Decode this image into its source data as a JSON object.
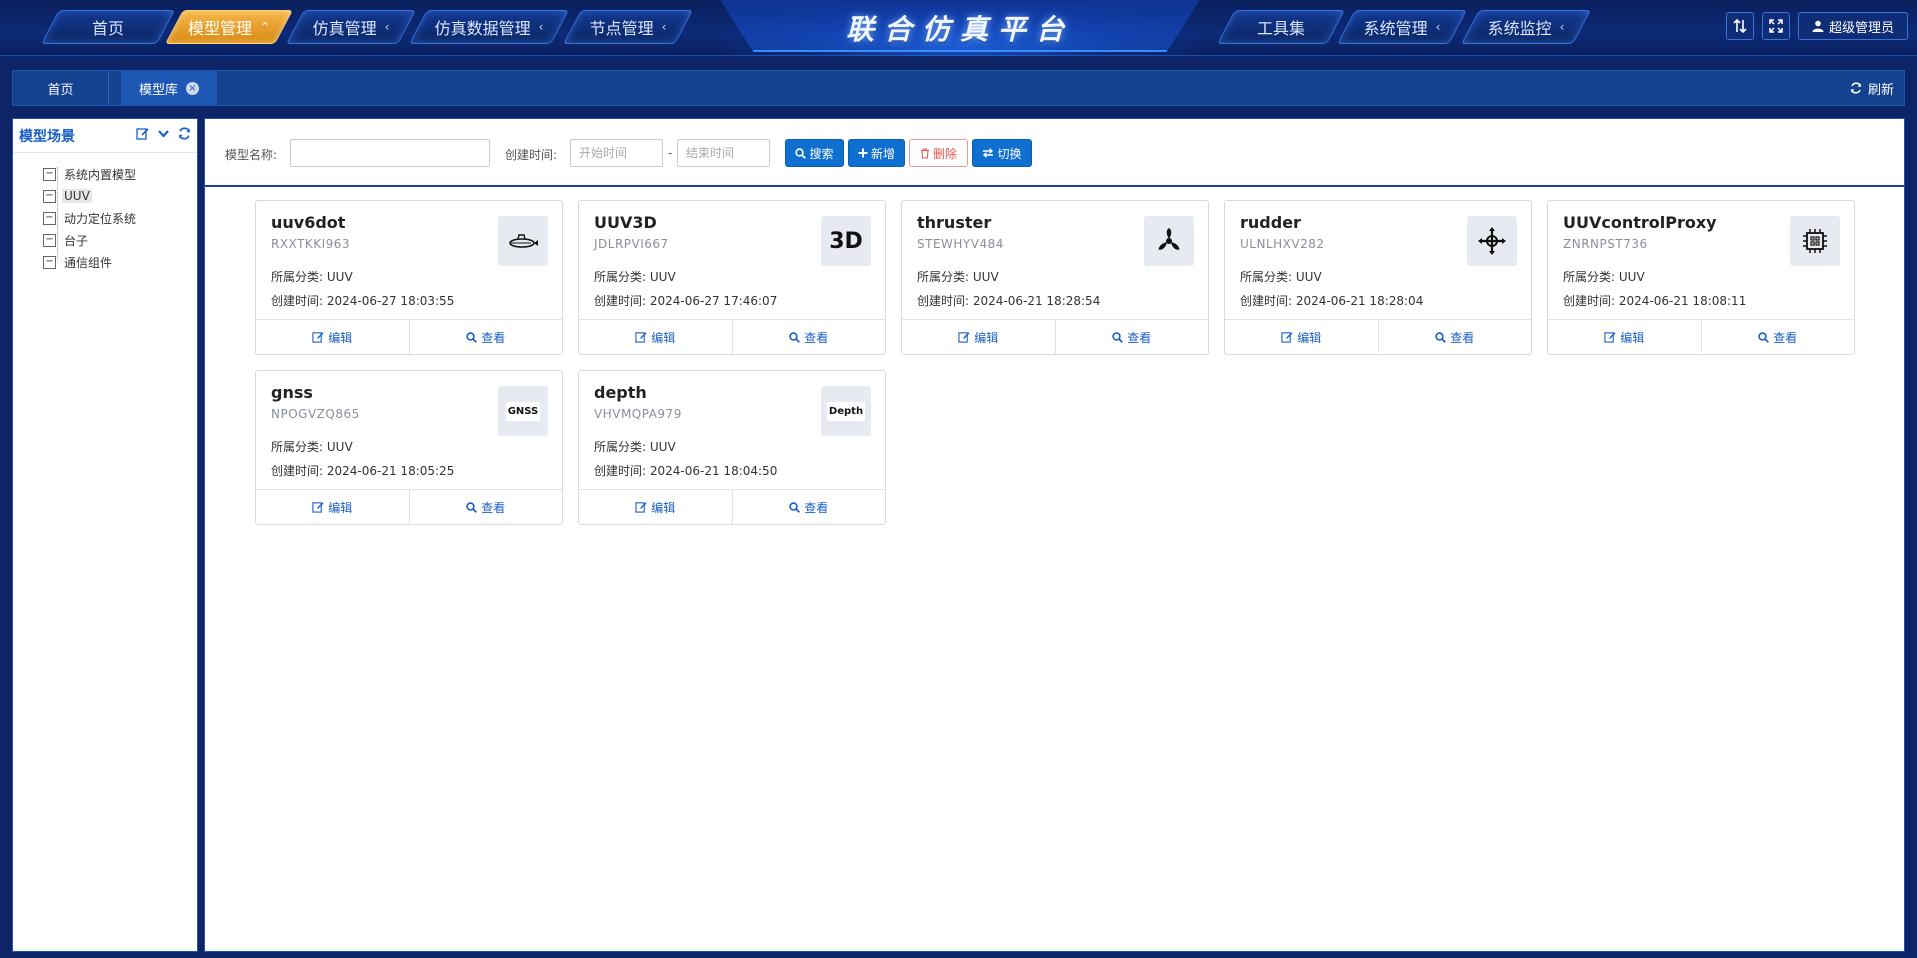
{
  "header": {
    "title": "联合仿真平台",
    "nav_left": [
      {
        "label": "首页",
        "active": false,
        "chevron": ""
      },
      {
        "label": "模型管理",
        "active": true,
        "chevron": "⌃"
      },
      {
        "label": "仿真管理",
        "active": false,
        "chevron": "‹"
      },
      {
        "label": "仿真数据管理",
        "active": false,
        "chevron": "‹"
      },
      {
        "label": "节点管理",
        "active": false,
        "chevron": "‹"
      }
    ],
    "nav_right": [
      {
        "label": "工具集",
        "chevron": ""
      },
      {
        "label": "系统管理",
        "chevron": "‹"
      },
      {
        "label": "系统监控",
        "chevron": "‹"
      }
    ],
    "user": "超级管理员"
  },
  "tabs": {
    "home": "首页",
    "current": "模型库",
    "close": "×",
    "refresh": "刷新"
  },
  "left": {
    "title": "模型场景",
    "tree": [
      {
        "label": "系统内置模型",
        "selected": false
      },
      {
        "label": "UUV",
        "selected": true
      },
      {
        "label": "动力定位系统",
        "selected": false
      },
      {
        "label": "台子",
        "selected": false
      },
      {
        "label": "通信组件",
        "selected": false
      }
    ]
  },
  "search": {
    "name_label": "模型名称:",
    "name_value": "",
    "time_label": "创建时间:",
    "start_placeholder": "开始时间",
    "end_placeholder": "结束时间",
    "dash": "-",
    "search_btn": "搜索",
    "add_btn": "新增",
    "delete_btn": "删除",
    "switch_btn": "切换"
  },
  "card_labels": {
    "category_prefix": "所属分类:",
    "time_prefix": "创建时间:",
    "edit": "编辑",
    "view": "查看"
  },
  "cards": [
    {
      "name": "uuv6dot",
      "code": "RXXTKKI963",
      "category": "UUV",
      "time": "2024-06-27 18:03:55",
      "icon": "submarine-icon"
    },
    {
      "name": "UUV3D",
      "code": "JDLRPVI667",
      "category": "UUV",
      "time": "2024-06-27 17:46:07",
      "icon": "3d-icon",
      "icon_text": "3D"
    },
    {
      "name": "thruster",
      "code": "STEWHYV484",
      "category": "UUV",
      "time": "2024-06-21 18:28:54",
      "icon": "propeller-icon"
    },
    {
      "name": "rudder",
      "code": "ULNLHXV282",
      "category": "UUV",
      "time": "2024-06-21 18:28:04",
      "icon": "crosshair-arrows-icon"
    },
    {
      "name": "UUVcontrolProxy",
      "code": "ZNRNPST736",
      "category": "UUV",
      "time": "2024-06-21 18:08:11",
      "icon": "chip-icon"
    },
    {
      "name": "gnss",
      "code": "NPOGVZQ865",
      "category": "UUV",
      "time": "2024-06-21 18:05:25",
      "icon": "gnss-icon",
      "icon_text": "GNSS"
    },
    {
      "name": "depth",
      "code": "VHVMQPA979",
      "category": "UUV",
      "time": "2024-06-21 18:04:50",
      "icon": "depth-icon",
      "icon_text": "Depth"
    }
  ],
  "colors": {
    "nav_bg": "#0c2a78",
    "nav_active": "#e89a22",
    "accent": "#1b5fc9",
    "primary_btn": "#0f6fd1",
    "danger": "#e05a4e"
  }
}
